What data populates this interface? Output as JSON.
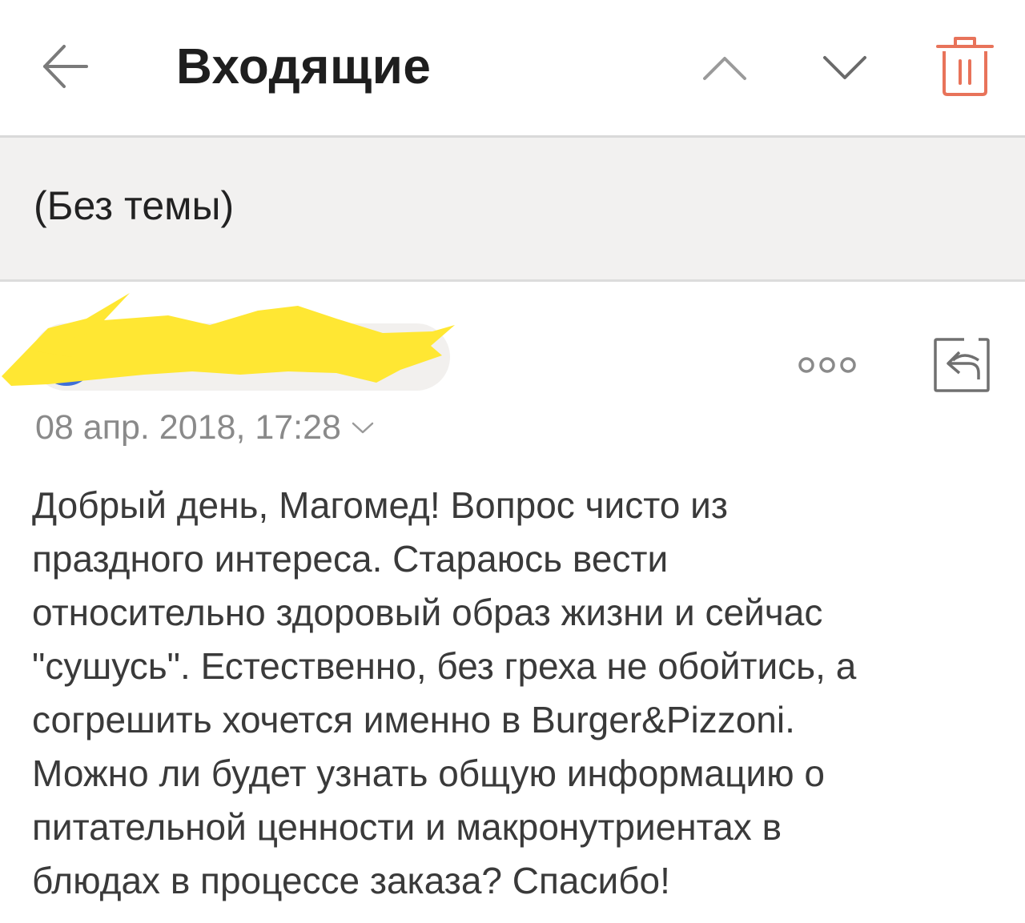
{
  "header": {
    "title": "Входящие",
    "back_icon": "arrow-left-icon",
    "prev_icon": "chevron-up-icon",
    "next_icon": "chevron-down-icon",
    "delete_icon": "trash-icon",
    "accent_color": "#e8735a",
    "icon_color": "#7a7a7a"
  },
  "subject": {
    "text": "(Без темы)"
  },
  "sender": {
    "avatar_color": "#3f6fd8",
    "redaction_color": "#ffe733",
    "more_icon": "more-dots-icon",
    "reply_icon": "reply-icon",
    "date": "08 апр. 2018, 17:28",
    "date_expand_icon": "chevron-down-icon"
  },
  "body": {
    "lines": [
      "Добрый день, Магомед! Вопрос чисто из",
      "праздного интереса. Стараюсь вести",
      "относительно здоровый образ жизни и сейчас",
      "\"сушусь\". Естественно, без греха не обойтись, а",
      "согрешить хочется именно в Burger&Pizzoni.",
      "Можно ли будет узнать общую информацию о",
      "питательной ценности и макронутриентах в",
      "блюдах в процессе заказа? Спасибо!"
    ]
  }
}
